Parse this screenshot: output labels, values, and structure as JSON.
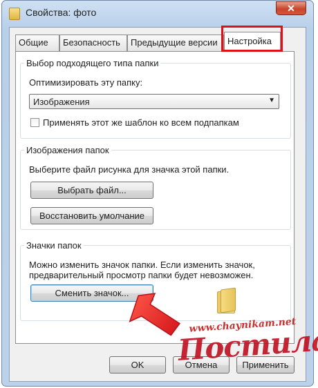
{
  "window": {
    "title": "Свойства: фото",
    "close_glyph": "✕"
  },
  "tabs": [
    {
      "label": "Общие"
    },
    {
      "label": "Безопасность"
    },
    {
      "label": "Предыдущие версии"
    },
    {
      "label": "Настройка",
      "active": true
    }
  ],
  "folder_type": {
    "legend": "Выбор подходящего типа папки",
    "optimize_label": "Оптимизировать эту папку:",
    "select_value": "Изображения",
    "apply_all_label": "Применять этот же шаблон ко всем подпапкам",
    "apply_all_checked": false
  },
  "folder_pictures": {
    "legend": "Изображения папок",
    "description": "Выберите файл рисунка для значка этой папки.",
    "choose_file_label": "Выбрать файл...",
    "restore_default_label": "Восстановить умолчание"
  },
  "folder_icons": {
    "legend": "Значки папок",
    "description_line1": "Можно изменить значок папки. Если изменить значок,",
    "description_line2": "предварительный просмотр папки будет невозможен.",
    "change_icon_label": "Сменить значок..."
  },
  "footer": {
    "ok_label": "OK",
    "cancel_label": "Отмена",
    "apply_label": "Применить"
  },
  "watermark": {
    "url": "www.chaynikam.net",
    "text": "Постила.ру"
  },
  "colors": {
    "highlight": "#e0101a",
    "arrow": "#e31e24"
  },
  "icons": {
    "title": "folder-icon",
    "close": "close-icon",
    "arrow": "red-arrow-icon",
    "preview": "folder-preview-icon"
  }
}
